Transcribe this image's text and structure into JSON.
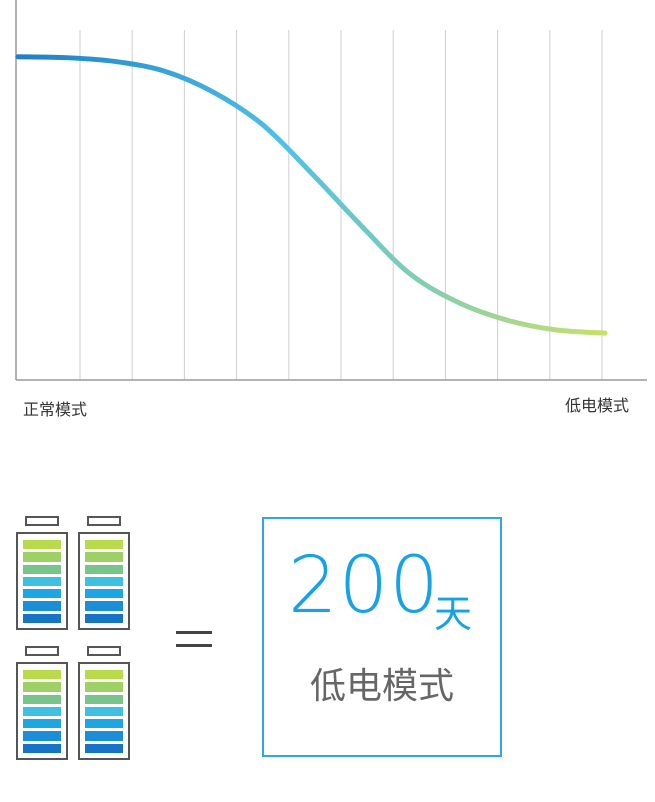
{
  "chart_data": {
    "type": "line",
    "x_labels": {
      "start": "正常模式",
      "end": "低电模式"
    },
    "vertical_gridlines": 12,
    "series": [
      {
        "x": [
          0,
          1,
          2,
          3,
          4,
          5,
          6,
          7,
          8,
          9,
          10,
          11,
          12
        ],
        "values": [
          100,
          99.7,
          98.5,
          95.5,
          89,
          79,
          64,
          48,
          33,
          24,
          18.5,
          15.5,
          14.5
        ]
      }
    ],
    "colors": {
      "start": "#1e7fc6",
      "middle": "#4fc0e6",
      "end": "#c8e06a"
    },
    "ylim": [
      0,
      105
    ],
    "grid": true
  },
  "comparison": {
    "equals_symbol": "=",
    "battery_count": 4,
    "battery_cell_colors": [
      "#b9da4a",
      "#9dd166",
      "#78c58a",
      "#3ec0e0",
      "#1ea6e3",
      "#1b8ed7",
      "#1673c6"
    ],
    "result_value": "200",
    "result_unit": "天",
    "result_mode": "低电模式"
  }
}
